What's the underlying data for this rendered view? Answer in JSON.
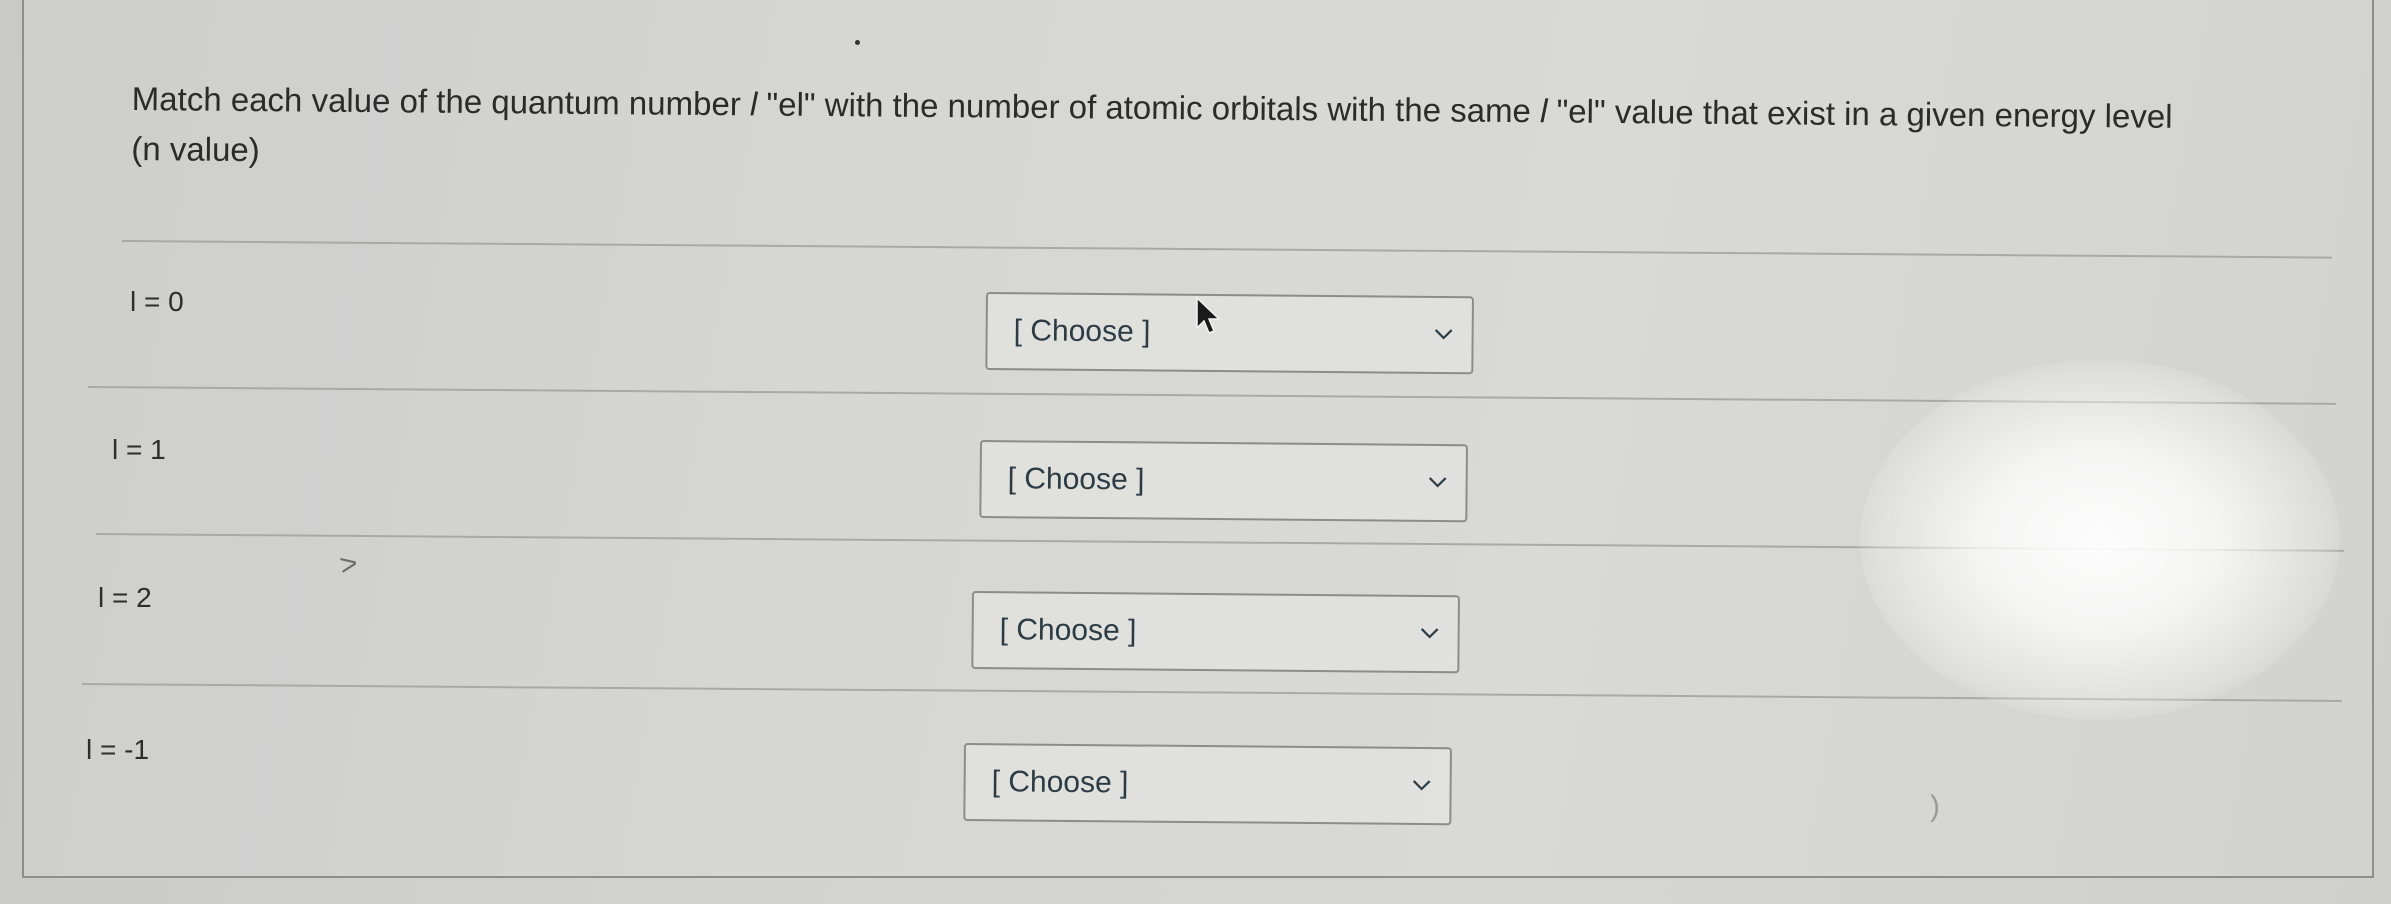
{
  "question": {
    "prefix": "Match each value of the quantum number ",
    "ell_symbol": "l",
    "middle": " \"el\" with the number of atomic orbitals with the same ",
    "ell_symbol_2": "l",
    "suffix": " \"el\" value that exist in a given energy level",
    "line2": "(n value)"
  },
  "rows": [
    {
      "label": "l = 0",
      "select_value": "[ Choose ]"
    },
    {
      "label": "l = 1",
      "select_value": "[ Choose ]"
    },
    {
      "label": "l = 2",
      "select_value": "[ Choose ]"
    },
    {
      "label": "l = -1",
      "select_value": "[ Choose ]"
    }
  ],
  "marks": {
    "bracket": ")",
    "stray": "˃"
  },
  "icons": {
    "chevron": "chevron-down-icon",
    "cursor": "mouse-pointer-icon"
  }
}
